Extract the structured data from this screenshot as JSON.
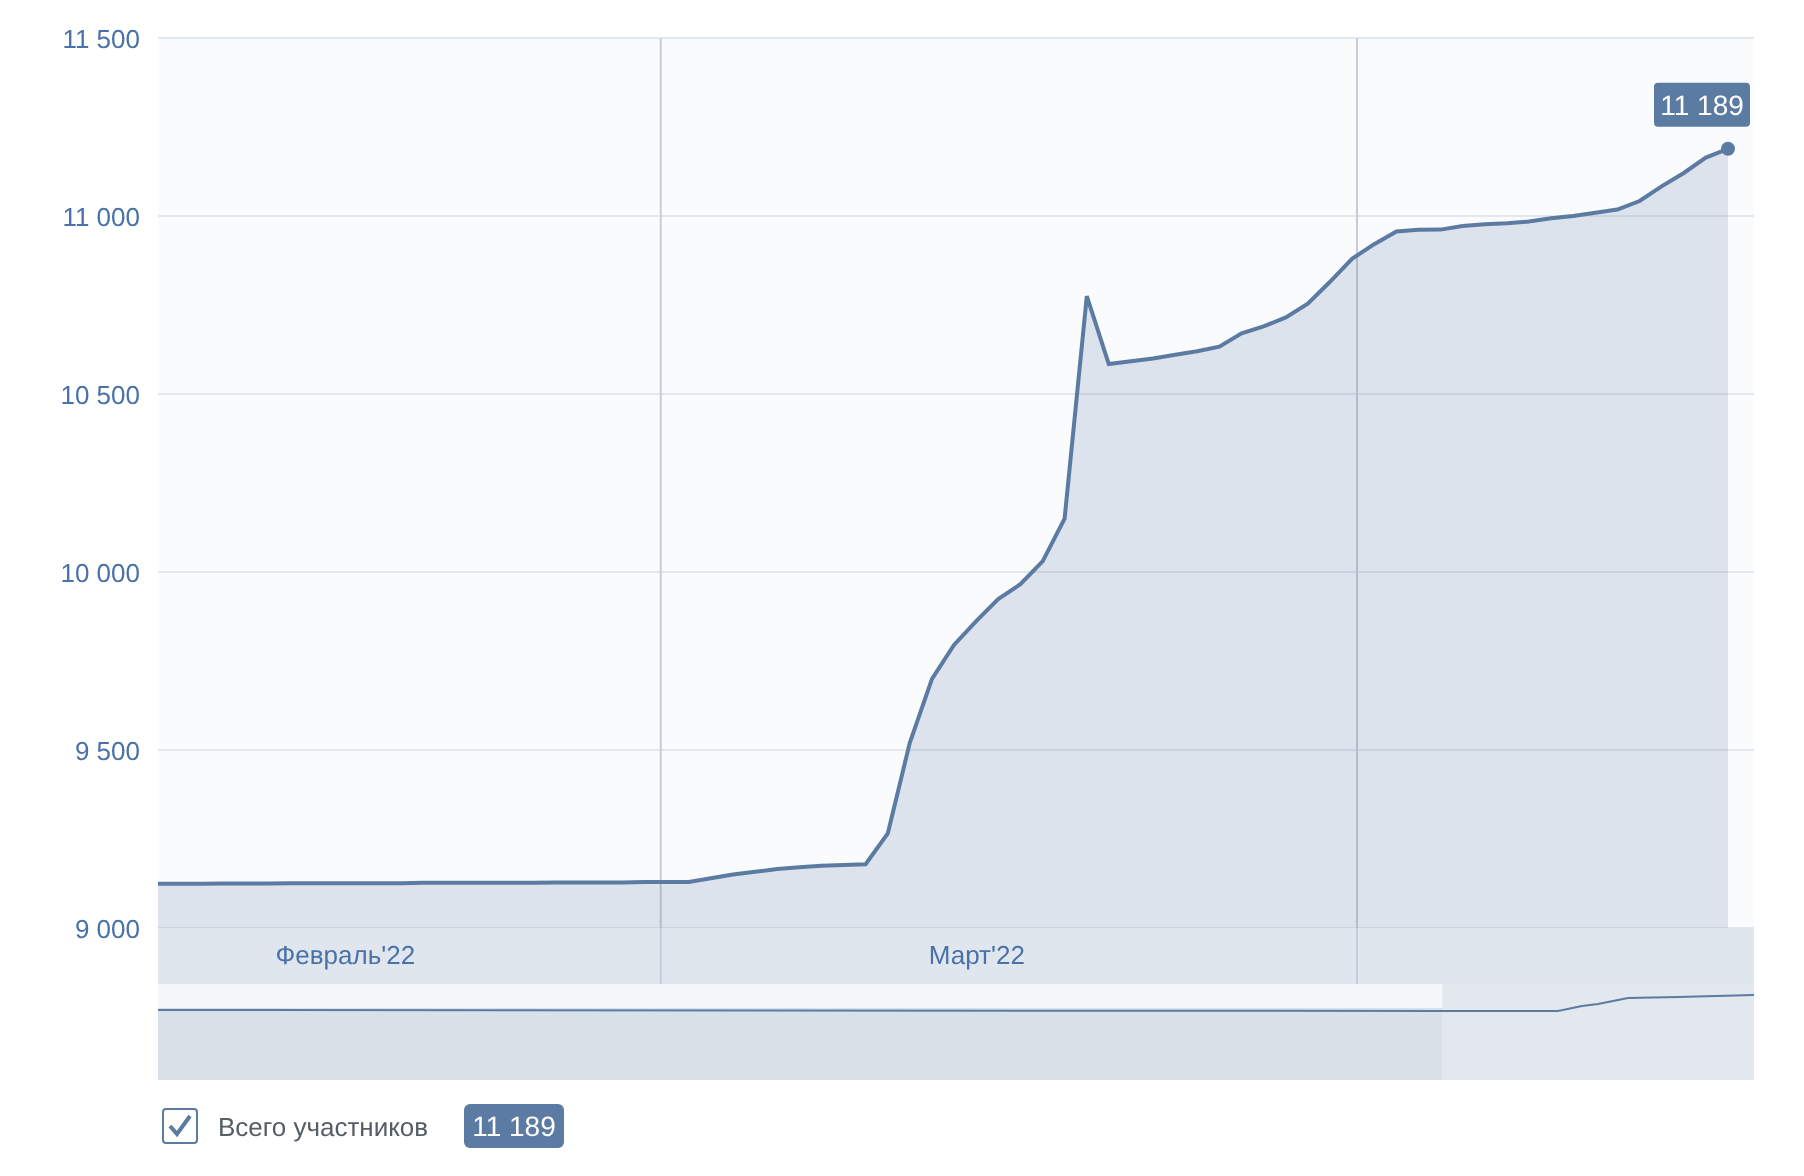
{
  "chart": {
    "month_bands": [
      {
        "label": "Февраль'22"
      },
      {
        "label": "Март'22"
      }
    ],
    "tooltip": "11 189",
    "chart_data": {
      "type": "area",
      "grid": true,
      "ylim": [
        9000,
        11500
      ],
      "yticks": [
        {
          "value": 9000,
          "label": "9 000"
        },
        {
          "value": 9500,
          "label": "9 500"
        },
        {
          "value": 10000,
          "label": "10 000"
        },
        {
          "value": 10500,
          "label": "10 500"
        },
        {
          "value": 11000,
          "label": "11 000"
        },
        {
          "value": 11500,
          "label": "11 500"
        }
      ],
      "categories": [
        null,
        null,
        null,
        null,
        null,
        null,
        null,
        null,
        null,
        null,
        null,
        null,
        null,
        null,
        null,
        null,
        null,
        null,
        null,
        null,
        null,
        null,
        null,
        null,
        null,
        null,
        null,
        null,
        null,
        null,
        null,
        null,
        null,
        null,
        null,
        null,
        null,
        null,
        null,
        null,
        null,
        null,
        null,
        null,
        null,
        null,
        null,
        null,
        null,
        null,
        null,
        null,
        null,
        null,
        null,
        null,
        null,
        null,
        null,
        null,
        null,
        null,
        null,
        null,
        null,
        null,
        null,
        null,
        null,
        null,
        null,
        null
      ],
      "series": [
        {
          "name": "Всего участников",
          "color": "#5b7ba3",
          "values": [
            9124,
            9124,
            9124,
            9125,
            9125,
            9125,
            9126,
            9126,
            9126,
            9126,
            9126,
            9126,
            9127,
            9127,
            9127,
            9127,
            9127,
            9127,
            9128,
            9128,
            9128,
            9128,
            9129,
            9129,
            9129,
            9140,
            9150,
            9158,
            9166,
            9171,
            9175,
            9177,
            9179,
            9266,
            9520,
            9700,
            9795,
            9862,
            9924,
            9966,
            10030,
            10150,
            10775,
            10584,
            10592,
            10600,
            10610,
            10620,
            10633,
            10670,
            10690,
            10715,
            10754,
            10815,
            10880,
            10921,
            10957,
            10961,
            10962,
            10972,
            10977,
            10980,
            10984,
            10994,
            11000,
            11009,
            11018,
            11042,
            11083,
            11121,
            11164,
            11189
          ]
        }
      ]
    }
  },
  "legend": {
    "checked": true,
    "value": "11 189"
  }
}
